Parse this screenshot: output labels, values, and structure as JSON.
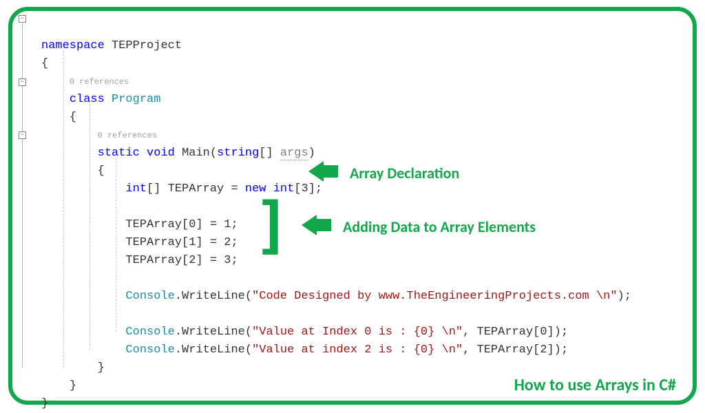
{
  "code": {
    "ns_kw": "namespace",
    "ns_name": "TEPProject",
    "brace_open": "{",
    "brace_close": "}",
    "ref0": "0 references",
    "class_kw": "class",
    "class_name": "Program",
    "ref1": "0 references",
    "method_sig_static": "static",
    "method_sig_void": "void",
    "method_name": "Main",
    "method_params_open": "(",
    "method_param_type": "string",
    "method_param_brackets": "[]",
    "method_param_name": "args",
    "method_params_close": ")",
    "decl_type": "int",
    "decl_brackets": "[]",
    "decl_name": "TEPArray",
    "decl_eq": " = ",
    "decl_new": "new",
    "decl_new_type": "int",
    "decl_size": "[3];",
    "assign0": "TEPArray[0] = 1;",
    "assign1": "TEPArray[1] = 2;",
    "assign2": "TEPArray[2] = 3;",
    "cw": "Console",
    "wl": ".WriteLine(",
    "wl_close": ");",
    "str0": "\"Code Designed by www.TheEngineeringProjects.com \\n\"",
    "str1": "\"Value at Index 0 is : {0} \\n\"",
    "str2": "\"Value at index 2 is : {0} \\n\"",
    "arg1": ", TEPArray[0]",
    "arg2": ", TEPArray[2]"
  },
  "annotations": {
    "decl": "Array Declaration",
    "add": "Adding Data to Array Elements",
    "footer": "How to use Arrays in C#"
  }
}
